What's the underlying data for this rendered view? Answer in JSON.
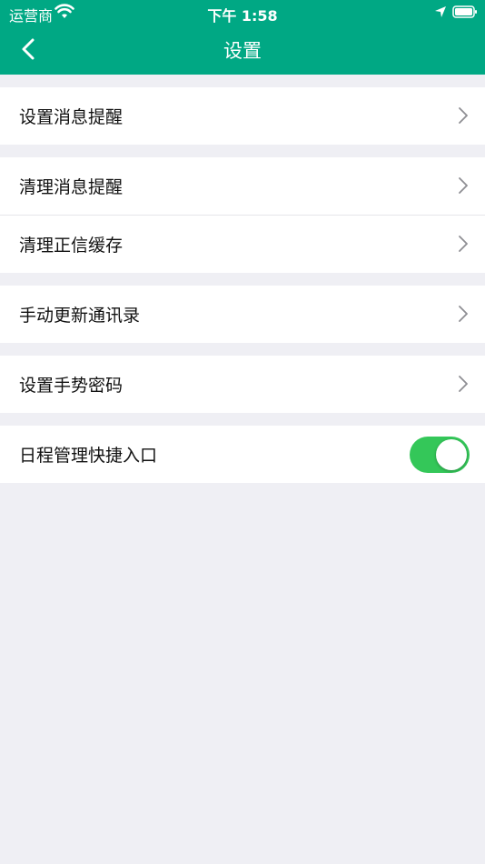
{
  "status": {
    "carrier": "运营商",
    "time": "下午 1:58",
    "icons": [
      "wifi-icon",
      "location-arrow-icon",
      "battery-icon"
    ]
  },
  "nav": {
    "back_icon": "chevron-left-icon",
    "title": "设置"
  },
  "colors": {
    "accent": "#00a884",
    "toggle_on": "#34c759",
    "background": "#efeff4"
  },
  "settings": {
    "message_reminder": "设置消息提醒",
    "clear_message_reminder": "清理消息提醒",
    "clear_cache": "清理正信缓存",
    "update_contacts": "手动更新通讯录",
    "gesture_password": "设置手势密码",
    "schedule_shortcut": "日程管理快捷入口",
    "schedule_shortcut_enabled": true
  }
}
